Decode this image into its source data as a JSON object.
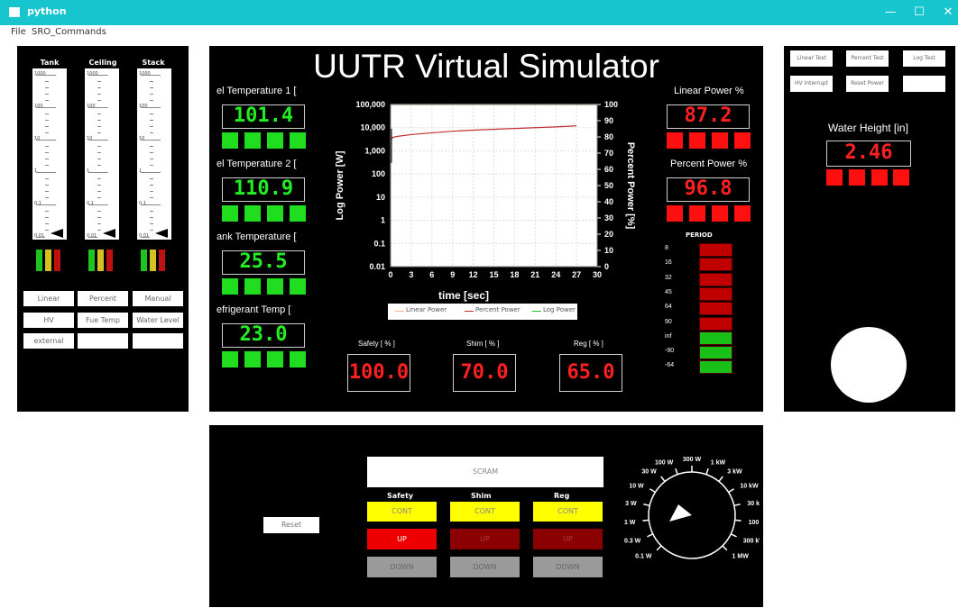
{
  "window": {
    "title": "python",
    "minimize": "—",
    "maximize": "☐",
    "close": "✕"
  },
  "menu": {
    "items": [
      "File",
      "SRO_Commands"
    ]
  },
  "left_panel": {
    "gauges": [
      {
        "label": "Tank",
        "ticks": [
          "1000",
          "100",
          "10",
          "1",
          "0.1",
          "0.01"
        ]
      },
      {
        "label": "Ceiling",
        "ticks": [
          "1000",
          "100",
          "10",
          "1",
          "0.1",
          "0.01"
        ]
      },
      {
        "label": "Stack",
        "ticks": [
          "1000",
          "100",
          "10",
          "1",
          "0.1",
          "0.01"
        ]
      }
    ],
    "buttons": [
      "Linear",
      "Percent",
      "Manual",
      "HV",
      "Fue Temp",
      "Water Level",
      "external",
      "",
      ""
    ]
  },
  "main_panel": {
    "title": "UUTR Virtual Simulator",
    "temps": [
      {
        "label": "el Temperature 1 [",
        "value": "101.4"
      },
      {
        "label": "el Temperature 2 [",
        "value": "110.9"
      },
      {
        "label": "ank Temperature [",
        "value": "25.5"
      },
      {
        "label": "efrigerant Temp [",
        "value": "23.0"
      }
    ],
    "powers": [
      {
        "label": "Linear Power %",
        "value": "87.2"
      },
      {
        "label": "Percent Power %",
        "value": "96.8"
      }
    ],
    "rods": [
      {
        "label": "Safety [ % ]",
        "value": "100.0"
      },
      {
        "label": "Shim [ % ]",
        "value": "70.0"
      },
      {
        "label": "Reg [ % ]",
        "value": "65.0"
      }
    ],
    "period": {
      "title": "PERIOD",
      "labels": [
        "8",
        "16",
        "32",
        "45",
        "64",
        "90",
        "inf",
        "-90",
        "-64"
      ],
      "colors": [
        "#c00000",
        "#c00000",
        "#c00000",
        "#c00000",
        "#c00000",
        "#c00000",
        "#18c018",
        "#18c018",
        "#18c018"
      ]
    }
  },
  "chart_data": {
    "type": "line",
    "xlabel": "time [sec]",
    "ylabel": "Log Power [W]",
    "y2label": "Percent Power [%]",
    "xticks": [
      "0",
      "3",
      "6",
      "9",
      "12",
      "15",
      "18",
      "21",
      "24",
      "27",
      "30"
    ],
    "yticks": [
      "100,000",
      "10,000",
      "1,000",
      "100",
      "10",
      "1",
      "0.1",
      "0.01"
    ],
    "y2ticks": [
      "100",
      "90",
      "80",
      "70",
      "60",
      "50",
      "40",
      "30",
      "20",
      "10",
      "0"
    ],
    "xlim": [
      0,
      30
    ],
    "ylim": [
      0.01,
      100000
    ],
    "y2lim": [
      0,
      100
    ],
    "legend": [
      "Linear Power",
      "Percent Power",
      "Log Power"
    ],
    "legend_position": "bottom",
    "series": [
      {
        "name": "Linear Power",
        "color": "#f2b48a",
        "x": [
          0,
          30
        ],
        "y": [
          100000,
          100000
        ]
      },
      {
        "name": "Percent Power",
        "color": "#c03030",
        "x": [
          0.1,
          0.3,
          1,
          3,
          6,
          9,
          12,
          15,
          18,
          21,
          24,
          27
        ],
        "y": [
          3000,
          3800,
          4200,
          5000,
          6000,
          7000,
          7800,
          8500,
          9200,
          10000,
          10800,
          12000
        ]
      },
      {
        "name": "Log Power",
        "color": "#20c020",
        "x": [
          0,
          30
        ],
        "y": [
          100000,
          100000
        ]
      }
    ]
  },
  "right_panel": {
    "buttons": [
      "Linear Test",
      "Percent Test",
      "Log Test",
      "HV Interrupt",
      "Reset Power",
      ""
    ],
    "water_label": "Water Height [in]",
    "water_value": "2.46"
  },
  "bottom_panel": {
    "reset": "Reset",
    "scram": "SCRAM",
    "rods": [
      {
        "name": "Safety",
        "cont": "CONT",
        "up": "UP",
        "down": "DOWN"
      },
      {
        "name": "Shim",
        "cont": "CONT",
        "up": "UP",
        "down": "DOWN"
      },
      {
        "name": "Reg",
        "cont": "CONT",
        "up": "UP",
        "down": "DOWN"
      }
    ],
    "dial_labels": [
      "0.1 W",
      "0.3 W",
      "1 W",
      "3 W",
      "10 W",
      "30 W",
      "100 W",
      "300 W",
      "1 kW",
      "3 kW",
      "10 kW",
      "30 kW",
      "100 kW",
      "300 kW",
      "1 MW"
    ]
  }
}
